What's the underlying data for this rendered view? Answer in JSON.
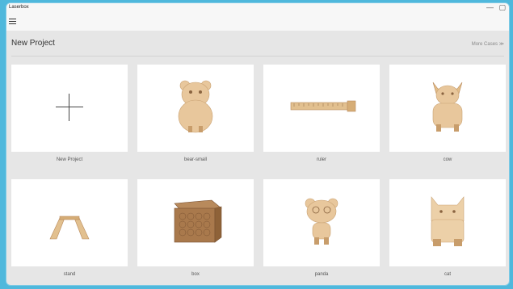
{
  "app": {
    "title": "Laserbox"
  },
  "window_controls": {
    "minimize": "—",
    "restore": "▢"
  },
  "header": {
    "title": "New Project",
    "more_cases": "More Cases ≫"
  },
  "projects": [
    {
      "label": "New Project",
      "icon": "plus-icon"
    },
    {
      "label": "bear-small",
      "icon": "bear-image"
    },
    {
      "label": "ruler",
      "icon": "ruler-image"
    },
    {
      "label": "cow",
      "icon": "cow-image"
    },
    {
      "label": "stand",
      "icon": "stand-image"
    },
    {
      "label": "box",
      "icon": "box-image"
    },
    {
      "label": "panda",
      "icon": "panda-image"
    },
    {
      "label": "cat",
      "icon": "cat-image"
    }
  ],
  "colors": {
    "frame": "#4fb8dc",
    "wood": "#e8c79c",
    "wood_dark": "#b8895a",
    "box_wood": "#a9794c"
  }
}
